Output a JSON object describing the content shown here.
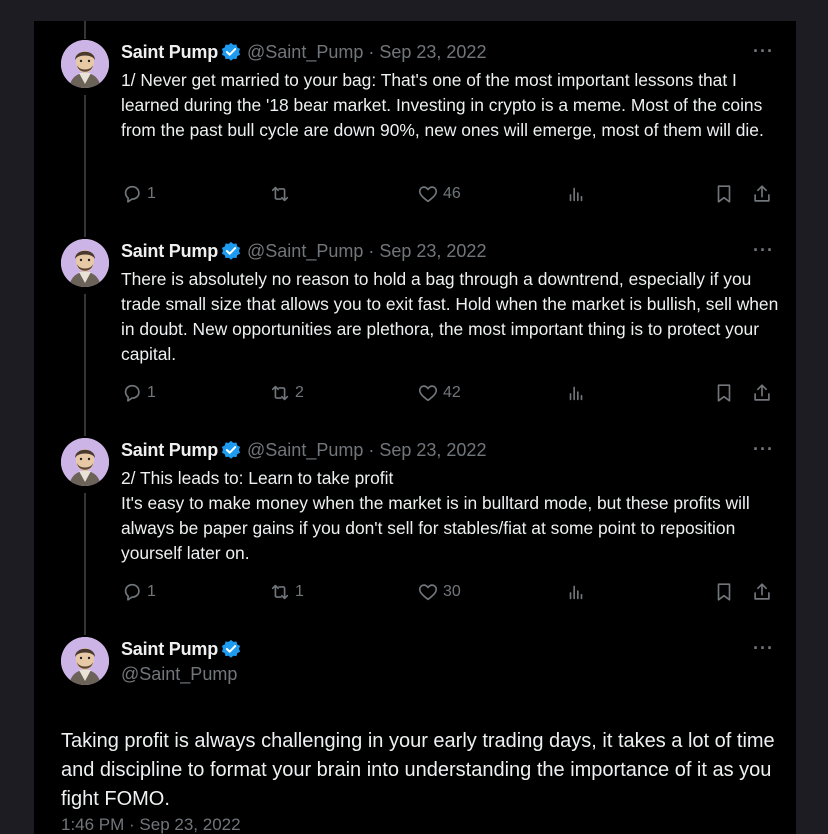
{
  "tweets": [
    {
      "name": "Saint Pump",
      "handle": "@Saint_Pump",
      "separator": "·",
      "date": "Sep 23, 2022",
      "more": "···",
      "text": "1/ Never get married to your bag: That's one of the most important lessons that I learned during the '18 bear market. Investing in crypto is a meme. Most of the coins from the past bull cycle are down 90%, new ones will emerge, most of them will die.",
      "replies": "1",
      "retweets": "",
      "likes": "46"
    },
    {
      "name": "Saint Pump",
      "handle": "@Saint_Pump",
      "separator": "·",
      "date": "Sep 23, 2022",
      "more": "···",
      "text": "There is absolutely no reason to hold a bag through a downtrend, especially if you trade small size that allows you to exit fast. Hold when the market is bullish, sell when in doubt. New opportunities are plethora, the most important thing is to protect your capital.",
      "replies": "1",
      "retweets": "2",
      "likes": "42"
    },
    {
      "name": "Saint Pump",
      "handle": "@Saint_Pump",
      "separator": "·",
      "date": "Sep 23, 2022",
      "more": "···",
      "text": "2/ This leads to: Learn to take profit\nIt's easy to make money when the market is in bulltard mode, but these profits will always be paper gains if you don't sell for stables/fiat at some point to reposition yourself later on.",
      "replies": "1",
      "retweets": "1",
      "likes": "30"
    }
  ],
  "main_tweet": {
    "name": "Saint Pump",
    "handle": "@Saint_Pump",
    "more": "···",
    "text": "Taking profit is always challenging in your early trading days, it takes a lot of time and discipline to format your brain into understanding the importance of it as you fight FOMO.",
    "timestamp": "1:46 PM · Sep 23, 2022"
  },
  "colors": {
    "background": "#000000",
    "muted": "#71767b",
    "verified": "#1d9bf0",
    "text": "#e7e9ea"
  },
  "icons": [
    "reply-icon",
    "retweet-icon",
    "like-icon",
    "views-icon",
    "bookmark-icon",
    "share-icon",
    "verified-badge-icon",
    "more-icon"
  ]
}
